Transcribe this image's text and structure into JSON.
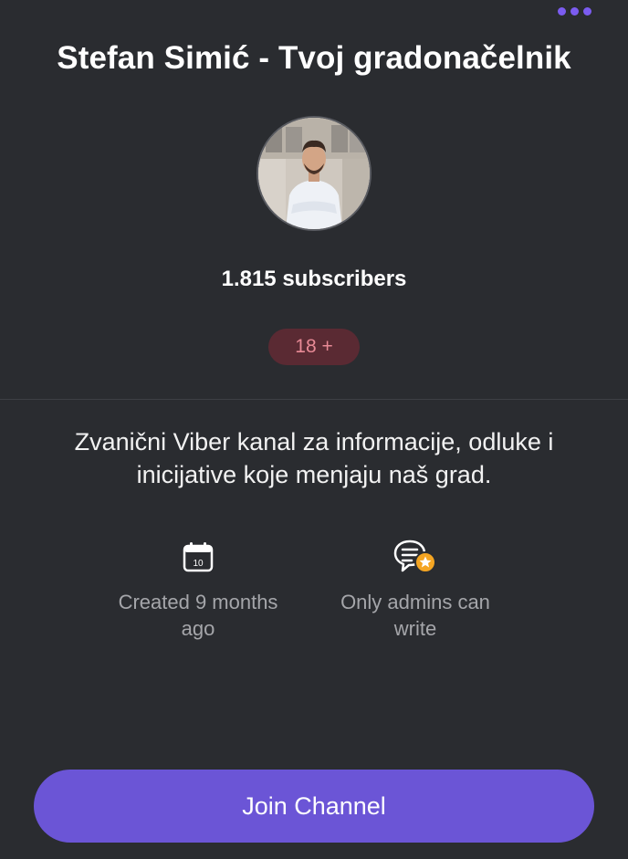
{
  "header": {
    "more_icon": "more-dots-icon",
    "accent_color": "#7b5cf0"
  },
  "channel": {
    "title": "Stefan Simić - Tvoj gradonačelnik",
    "subscribers": "1.815 subscribers",
    "age_badge": "18 +",
    "description": "Zvanični Viber kanal za informacije, odluke i inicijative koje menjaju naš grad."
  },
  "info": {
    "created": {
      "icon": "calendar-icon",
      "calendar_day": "10",
      "label": "Created 9 months ago"
    },
    "admins": {
      "icon": "chat-star-icon",
      "label": "Only admins can write"
    }
  },
  "actions": {
    "join_label": "Join Channel",
    "join_color": "#6b55d6"
  }
}
